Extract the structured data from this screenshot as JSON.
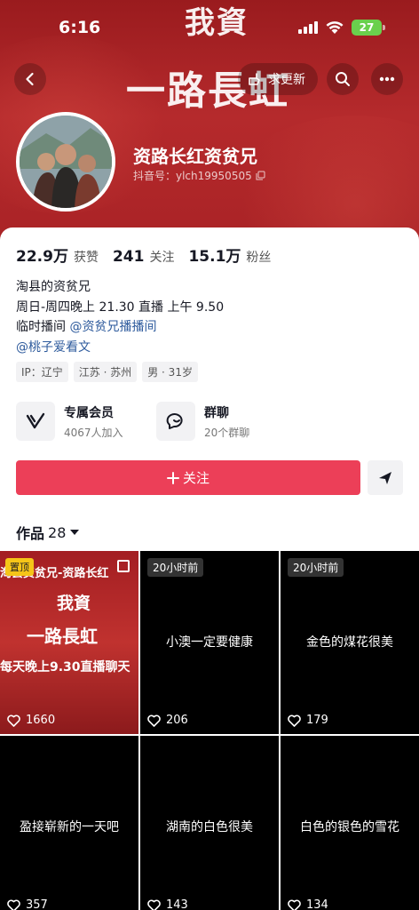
{
  "status_bar": {
    "time": "6:16",
    "battery": "27"
  },
  "banner": {
    "title_line1": "我資",
    "title_line2": "一路長虹"
  },
  "nav": {
    "update_label": "求更新"
  },
  "profile": {
    "nickname": "资路长红资贫兄",
    "douyin_id": "抖音号：ylch19950505"
  },
  "stats": [
    {
      "value": "22.9万",
      "label": "获赞"
    },
    {
      "value": "241",
      "label": "关注"
    },
    {
      "value": "15.1万",
      "label": "粉丝"
    }
  ],
  "bio": {
    "line1": "淘县的资贫兄",
    "line2": "周日-周四晚上 21.30 直播 上午 9.50",
    "line3_prefix": "临时播间 ",
    "line3_link": "@资贫兄播播间",
    "line4_link": "@桃子爱看文"
  },
  "tags": [
    "IP：辽宁",
    "江苏 · 苏州",
    "男 · 31岁"
  ],
  "features": {
    "member": {
      "title": "专属会员",
      "subtitle": "4067人加入"
    },
    "group": {
      "title": "群聊",
      "subtitle": "20个群聊"
    }
  },
  "follow_label": "关注",
  "works": {
    "label": "作品",
    "count": "28"
  },
  "grid": {
    "pinned": {
      "badge": "置顶",
      "title": "淘县资贫兄-资路长红",
      "line1": "我資",
      "line2": "一路長虹",
      "line3": "每天晚上9.30直播聊天",
      "likes": "1660"
    },
    "items": [
      {
        "badge": "20小时前",
        "text": "小澳一定要健康",
        "likes": "206"
      },
      {
        "badge": "20小时前",
        "text": "金色的煤花很美",
        "likes": "179"
      },
      {
        "badge": "",
        "text": "盈接崭新的一天吧",
        "likes": "357"
      },
      {
        "badge": "",
        "text": "湖南的白色很美",
        "likes": "143"
      },
      {
        "badge": "",
        "text": "白色的银色的雪花",
        "likes": "134"
      }
    ]
  },
  "colors": {
    "accent": "#ec3f58",
    "banner": "#a82225",
    "link": "#2d5a9c"
  }
}
